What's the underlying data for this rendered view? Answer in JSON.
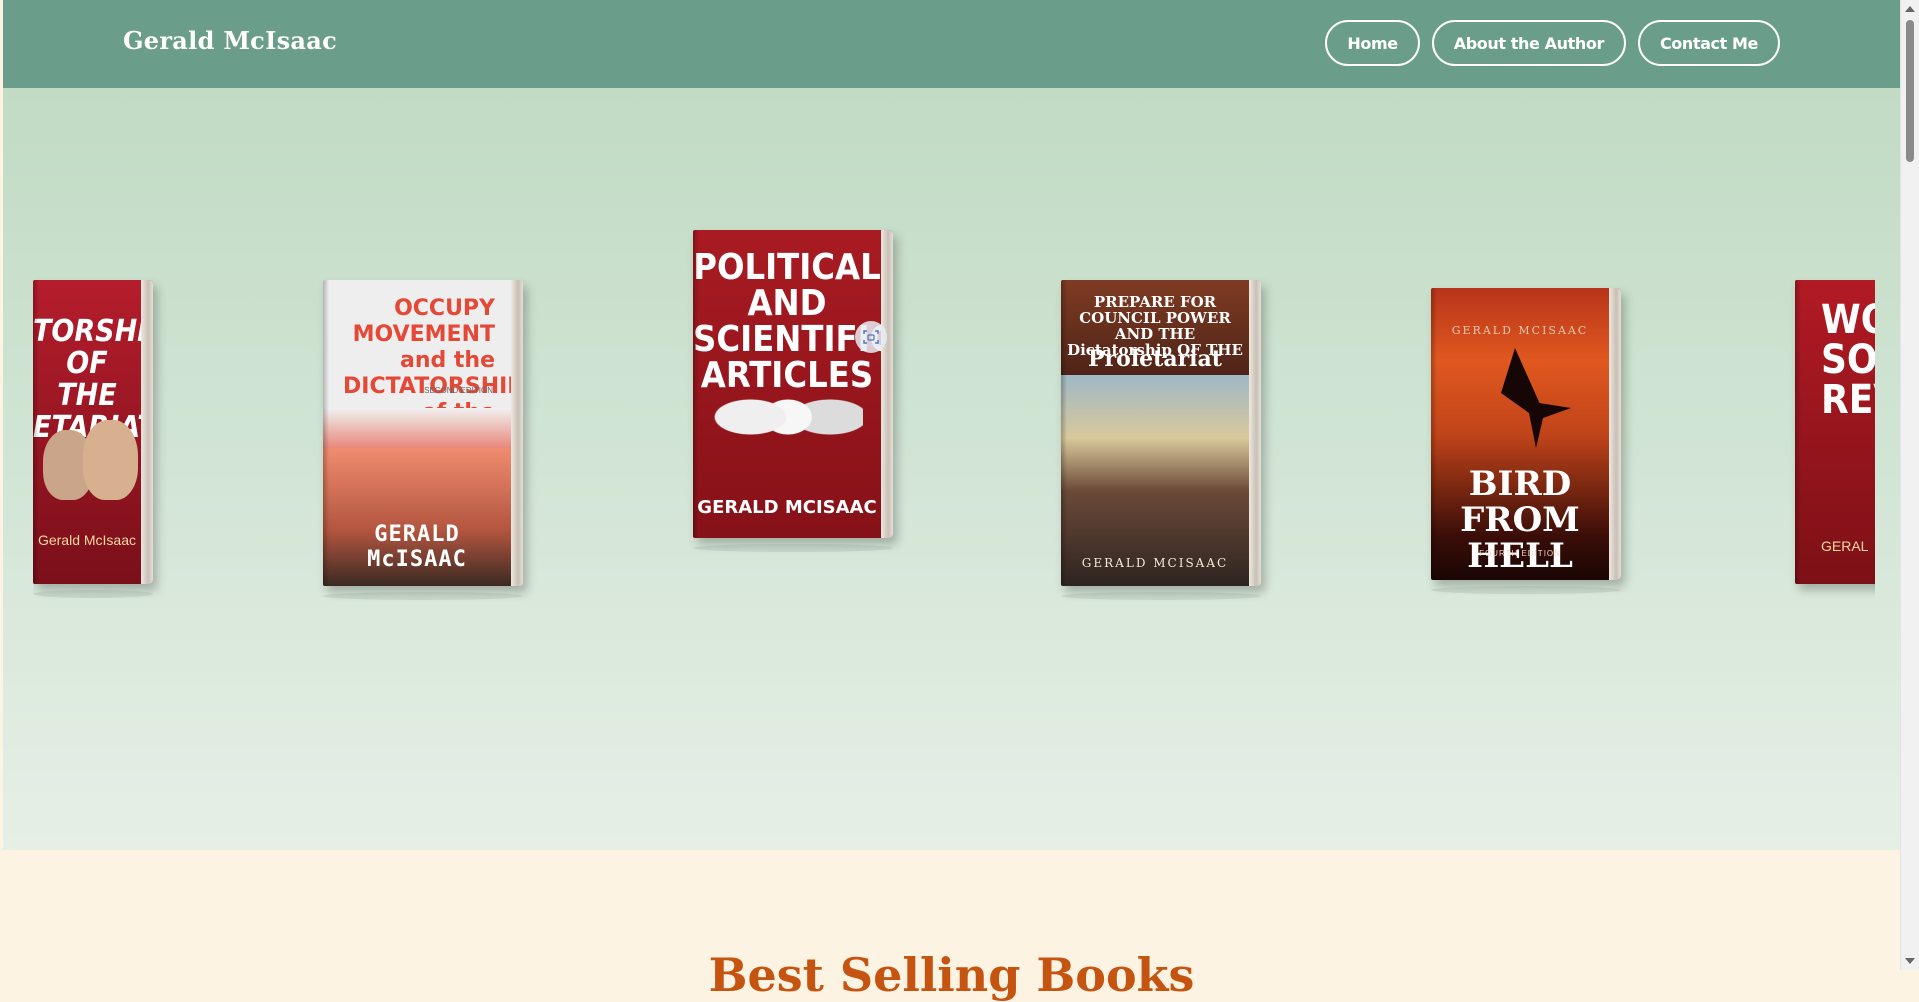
{
  "header": {
    "logo": "Gerald McIsaac",
    "nav": [
      {
        "label": "Home"
      },
      {
        "label": "About the Author"
      },
      {
        "label": "Contact Me"
      }
    ]
  },
  "carousel": {
    "books": [
      {
        "title": "TORSHIP OF THE ETARIAT",
        "author": "Gerald McIsaac"
      },
      {
        "title": "OCCUPY MOVEMENT and the DICTATORSHIP of the PROLETARIAT",
        "edition": "SECOND EDITION",
        "author": "GERALD McISAAC"
      },
      {
        "title": "POLITICAL AND SCIENTIFIC ARTICLES",
        "author": "GERALD MCISAAC"
      },
      {
        "title": "PREPARE FOR COUNCIL POWER AND THE Dictatorship OF THE",
        "title_big": "Proletariat",
        "author": "GERALD MCISAAC"
      },
      {
        "author": "GERALD MCISAAC",
        "title": "BIRD FROM HELL",
        "edition": "FOURTH EDITION"
      },
      {
        "title": "WO SOC REVO",
        "author": "GERAL"
      }
    ],
    "scan_icon": "scan-icon"
  },
  "section": {
    "title": "Best Selling Books"
  },
  "colors": {
    "header": "#6b9e8a",
    "accent": "#c65411"
  }
}
